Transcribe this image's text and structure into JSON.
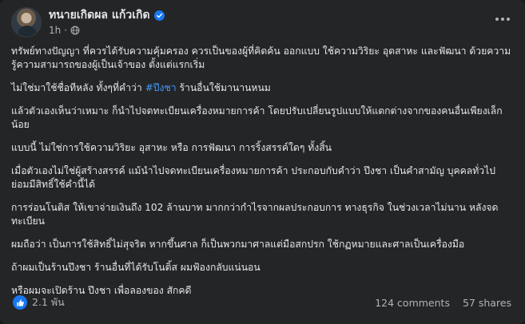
{
  "post": {
    "author": "ทนายเกิดผล แก้วเกิด",
    "time": "1h",
    "separator": "·",
    "paragraphs": [
      "ทรัพย์ทางปัญญา ที่ควรได้รับความคุ้มครอง ควรเป็นของผู้ที่คิดค้น ออกแบบ ใช้ความวิริยะ อุตสาหะ และฟัฒนา ด้วยความรู้ความสามารถของผู้เป็นเจ้าของ ตั้งแต่แรกเริ่ม",
      "แล้วตัวเองเห็นว่าเหมาะ ก็นำไปจดทะเบียนเครื่องหมายการค้า โดยปรับเปลี่ยนรูปแบบให้แตกต่างจากของคนอื่นเพียงเล็กน้อย",
      "แบบนี้ ไม่ใช่การใช้ความวิริยะ อุสาหะ หรือ การฟัฒนา การริ้งสรรค์ใดๆ ทั้งสิ้น",
      "เมื่อตัวเองไม่ใช่ผู้สร้างสรรค์ แม้นำไปจดทะเบียนเครื่องหมายการค้า ประกอบกับคำว่า ปึงชา เป็นคำสามัญ บุคคลทั่วไปย่อมมีสิทธิ์ใช้คำนี้ได้",
      "การร่อนโนติส ให้เขาจ่ายเงินถึง 102 ล้านบาท มากกว่ากำไรจากผลประกอบการ ทางธุรกิจ ในช่วงเวลาไม่นาน หลังจดทะเบียน",
      "ผมถือว่า เป็นการใช้สิทธิ์ไม่สุจริต หากขึ้นศาล ก็เป็นพวกมาศาลแต่มือสกปรก ใช้กฏหมายและศาลเป็นเครื่องมือ",
      "ถ้าผมเป็นร้านปึงชา ร้านอื่นที่ได้รับโนติ้ส ผมฟ้องกลับแน่นอน",
      "หรือผมจะเปิดร้าน ปึงชา เพื่อลองของ สักคดี"
    ],
    "hashtag_line": {
      "before": "ไม่ใช่มาใช้ชื่อทีหลัง ทั้งๆที่คำว่า ",
      "hashtag": "#ปึงชา",
      "after": " ร้านอื่นใช้มานานหนม"
    },
    "reactions": "2.1 พัน",
    "comments": "124 comments",
    "shares": "57 shares"
  },
  "colors": {
    "card_bg": "#242526",
    "text": "#e4e6eb",
    "secondary": "#b0b3b8",
    "link": "#4599ff",
    "like_blue": "#1877f2"
  },
  "icons": {
    "verified": "verified-badge-icon",
    "privacy": "globe-icon",
    "menu": "more-horizontal-icon",
    "reaction": "thumbs-up-icon"
  }
}
